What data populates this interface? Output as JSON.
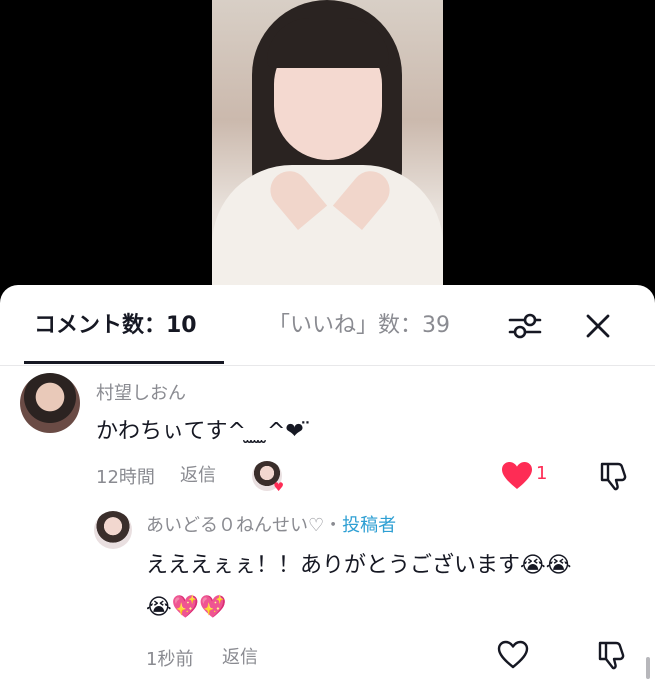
{
  "header": {
    "comments_tab": "コメント数：10",
    "likes_tab": "「いいね」数：39"
  },
  "comments": [
    {
      "username": "村望しおん",
      "text": "かわちぃてす^ ̫ ̫ ̫^❤︎ ̈",
      "time": "12時間",
      "reply_label": "返信",
      "likes": "1",
      "liked": true
    }
  ],
  "reply": {
    "username": "あいどる０ねんせい♡",
    "separator": "・",
    "creator_tag": "投稿者",
    "text_line1": "えええぇぇ！！ありがとうございます😭😭",
    "text_line2": "😭💖💖",
    "time": "1秒前",
    "reply_label": "返信"
  },
  "colors": {
    "accent_red": "#fe2c55",
    "creator_blue": "#2e9fd3",
    "muted_text": "#8a8b91"
  },
  "icons": {
    "filter": "filter-sliders-icon",
    "close": "close-icon",
    "like": "heart-icon",
    "dislike": "thumbs-down-icon"
  }
}
